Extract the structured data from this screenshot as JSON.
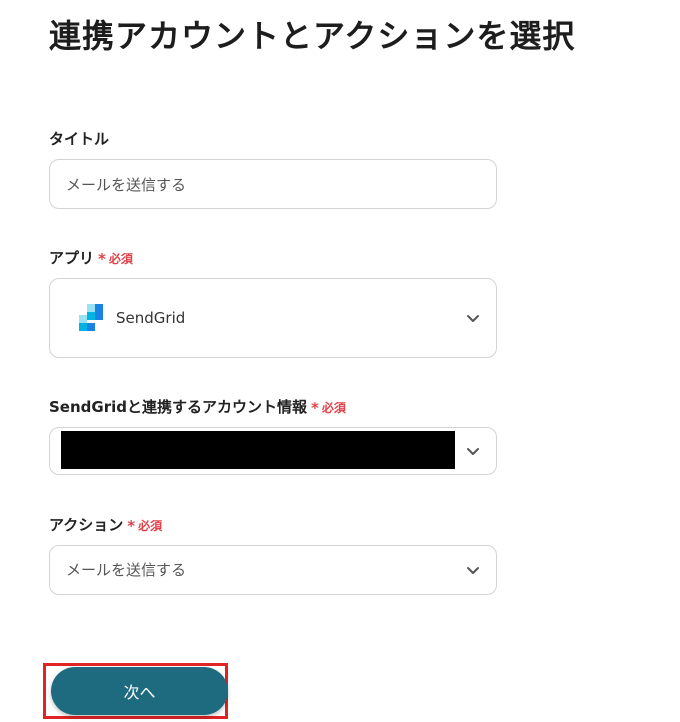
{
  "page": {
    "title": "連携アカウントとアクションを選択"
  },
  "title_field": {
    "label": "タイトル",
    "value": "メールを送信する"
  },
  "app_field": {
    "label": "アプリ",
    "required": "必須",
    "required_mark": "*",
    "selected_app": "SendGrid",
    "app_icon": "sendgrid-logo-icon"
  },
  "account_field": {
    "label": "SendGridと連携するアカウント情報",
    "required": "必須",
    "required_mark": "*",
    "value_redacted": true
  },
  "action_field": {
    "label": "アクション",
    "required": "必須",
    "required_mark": "*",
    "selected": "メールを送信する"
  },
  "next_button": {
    "label": "次へ"
  },
  "colors": {
    "required": "#e0434a",
    "button": "#1e6a7f",
    "highlight": "#e02424",
    "sendgrid_blue": "#1a82e2"
  }
}
